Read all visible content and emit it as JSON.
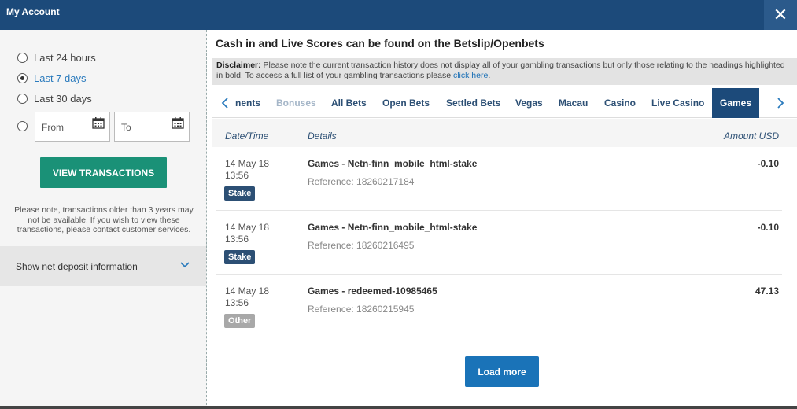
{
  "header": {
    "title": "My Account",
    "close_icon": "close-icon"
  },
  "filters": {
    "options": [
      {
        "label": "Last 24 hours",
        "checked": false
      },
      {
        "label": "Last 7 days",
        "checked": true
      },
      {
        "label": "Last 30 days",
        "checked": false
      }
    ],
    "from_label": "From",
    "to_label": "To",
    "view_button": "VIEW TRANSACTIONS",
    "note": "Please note, transactions older than 3 years may not be available. If you wish to view these transactions, please contact customer services.",
    "deposit_label": "Show net deposit information"
  },
  "main": {
    "notice": "Cash in and Live Scores can be found on the Betslip/Openbets",
    "disclaimer_bold": "Disclaimer:",
    "disclaimer_text": " Please note the current transaction history does not display all of your gambling transactions but only those relating to the headings highlighted in bold. To access a full list of your gambling transactions please ",
    "disclaimer_link": "click here",
    "disclaimer_end": ".",
    "tabs": [
      {
        "label": "nents"
      },
      {
        "label": "Bonuses"
      },
      {
        "label": "All Bets"
      },
      {
        "label": "Open Bets"
      },
      {
        "label": "Settled Bets"
      },
      {
        "label": "Vegas"
      },
      {
        "label": "Macau"
      },
      {
        "label": "Casino"
      },
      {
        "label": "Live Casino"
      },
      {
        "label": "Games"
      }
    ],
    "active_tab": "Games",
    "columns": {
      "date": "Date/Time",
      "details": "Details",
      "amount": "Amount USD"
    },
    "rows": [
      {
        "date": "14 May 18",
        "time": "13:56",
        "badge": "Stake",
        "details": "Games - Netn-finn_mobile_html-stake",
        "reference": "Reference: 18260217184",
        "amount": "-0.10"
      },
      {
        "date": "14 May 18",
        "time": "13:56",
        "badge": "Stake",
        "details": "Games - Netn-finn_mobile_html-stake",
        "reference": "Reference: 18260216495",
        "amount": "-0.10"
      },
      {
        "date": "14 May 18",
        "time": "13:56",
        "badge": "Other",
        "details": "Games - redeemed-10985465",
        "reference": "Reference: 18260215945",
        "amount": "47.13"
      }
    ],
    "load_more": "Load more"
  },
  "colors": {
    "header": "#1c4a7a",
    "view_button": "#1a9177",
    "load_more": "#1a73b8",
    "badge_stake": "#2c4f74",
    "badge_other": "#a8a8a8"
  }
}
